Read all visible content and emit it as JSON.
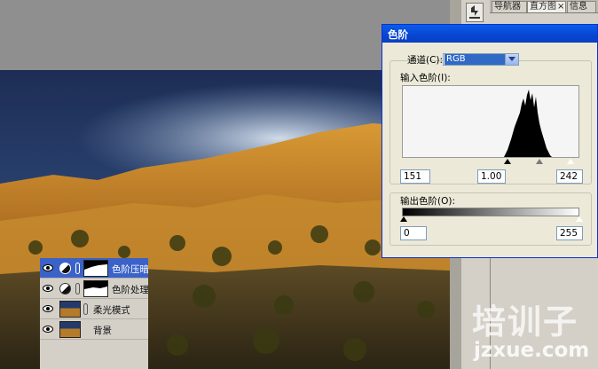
{
  "panel": {
    "tabs": [
      "导航器",
      "直方图",
      "信息"
    ],
    "close_glyph": "×"
  },
  "layers": [
    {
      "name": "色阶压暗天",
      "selected": true,
      "kind": "adjustment"
    },
    {
      "name": "色阶处理阴",
      "selected": false,
      "kind": "adjustment"
    },
    {
      "name": "柔光模式",
      "selected": false,
      "kind": "photo"
    },
    {
      "name": "背景",
      "selected": false,
      "kind": "photo"
    }
  ],
  "dialog": {
    "title": "色阶",
    "channel_label": "通道(C):",
    "channel_value": "RGB",
    "input_label": "输入色阶(I):",
    "input_black": "151",
    "input_gamma": "1.00",
    "input_white": "242",
    "output_label": "输出色阶(O):",
    "output_black": "0",
    "output_white": "255"
  },
  "watermark": {
    "text_cn": "培训子",
    "url": "jzxue.com"
  },
  "colors": {
    "accent": "#0845d2",
    "selection": "#3a62c8",
    "dialog_bg": "#ece9d8"
  },
  "icons": [
    "eye-icon",
    "adjustment-layer-icon",
    "link-chain-icon",
    "dropdown-arrow-icon",
    "tool-preset-icon"
  ]
}
